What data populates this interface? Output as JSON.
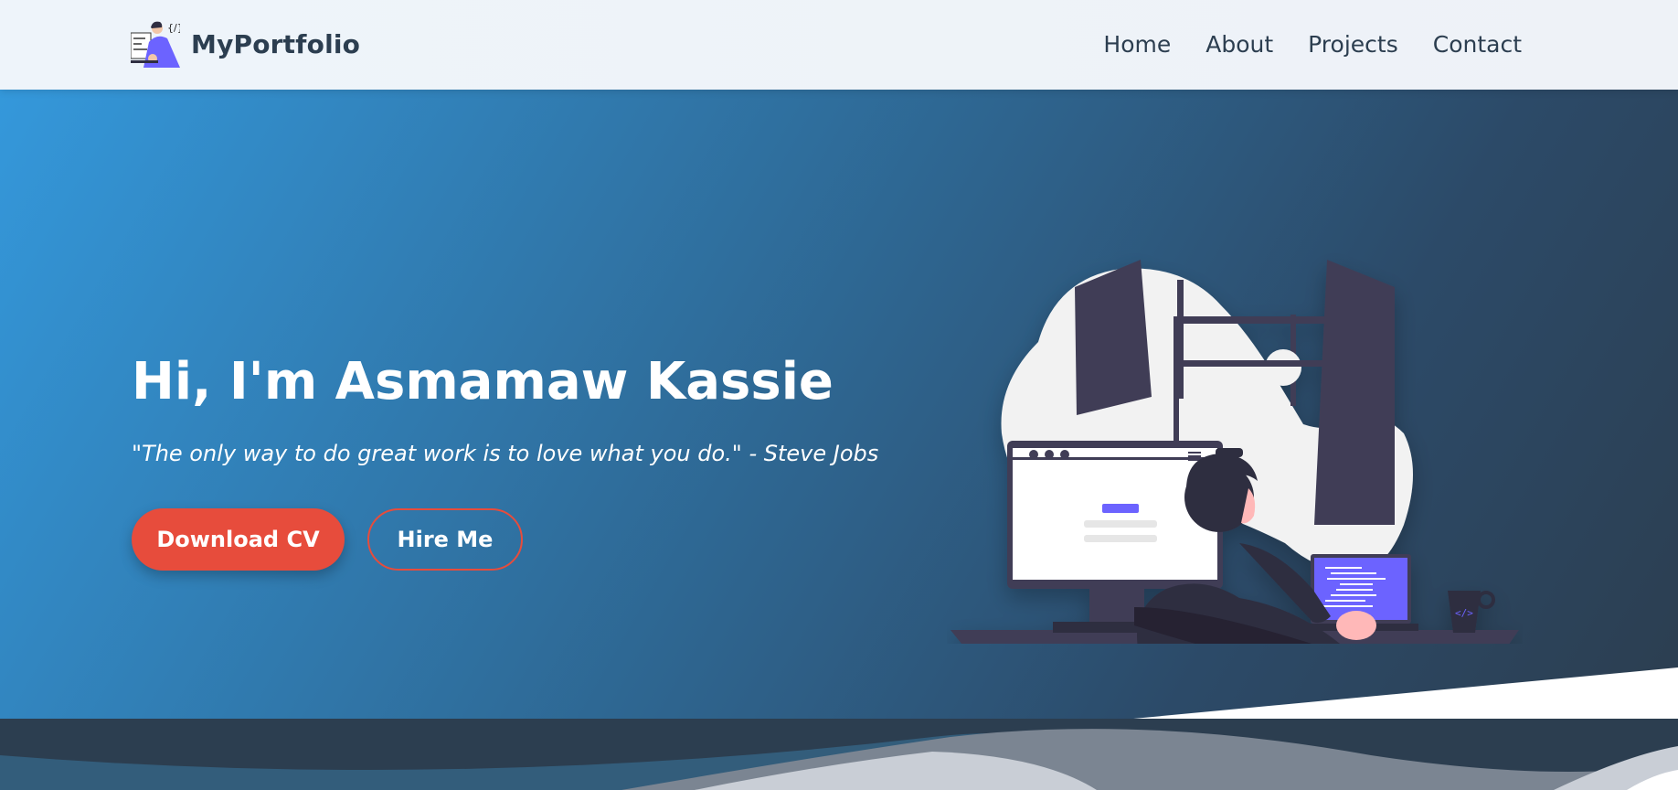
{
  "nav": {
    "brand": "MyPortfolio",
    "links": [
      "Home",
      "About",
      "Projects",
      "Contact"
    ]
  },
  "hero": {
    "title": "Hi, I'm Asmamaw Kassie",
    "quote": "\"The only way to do great work is to love what you do.\" - Steve Jobs",
    "primary_button": "Download CV",
    "secondary_button": "Hire Me"
  },
  "colors": {
    "accent": "#e74c3c",
    "hero_start": "#3498db",
    "hero_end": "#2c3e50",
    "nav_text": "#2c3e50",
    "illustration_purple": "#6c63ff"
  },
  "icons": {
    "brand_logo": "developer-avatar-icon",
    "illustration": "developer-at-desk-illustration",
    "mug": "code-mug-icon"
  }
}
